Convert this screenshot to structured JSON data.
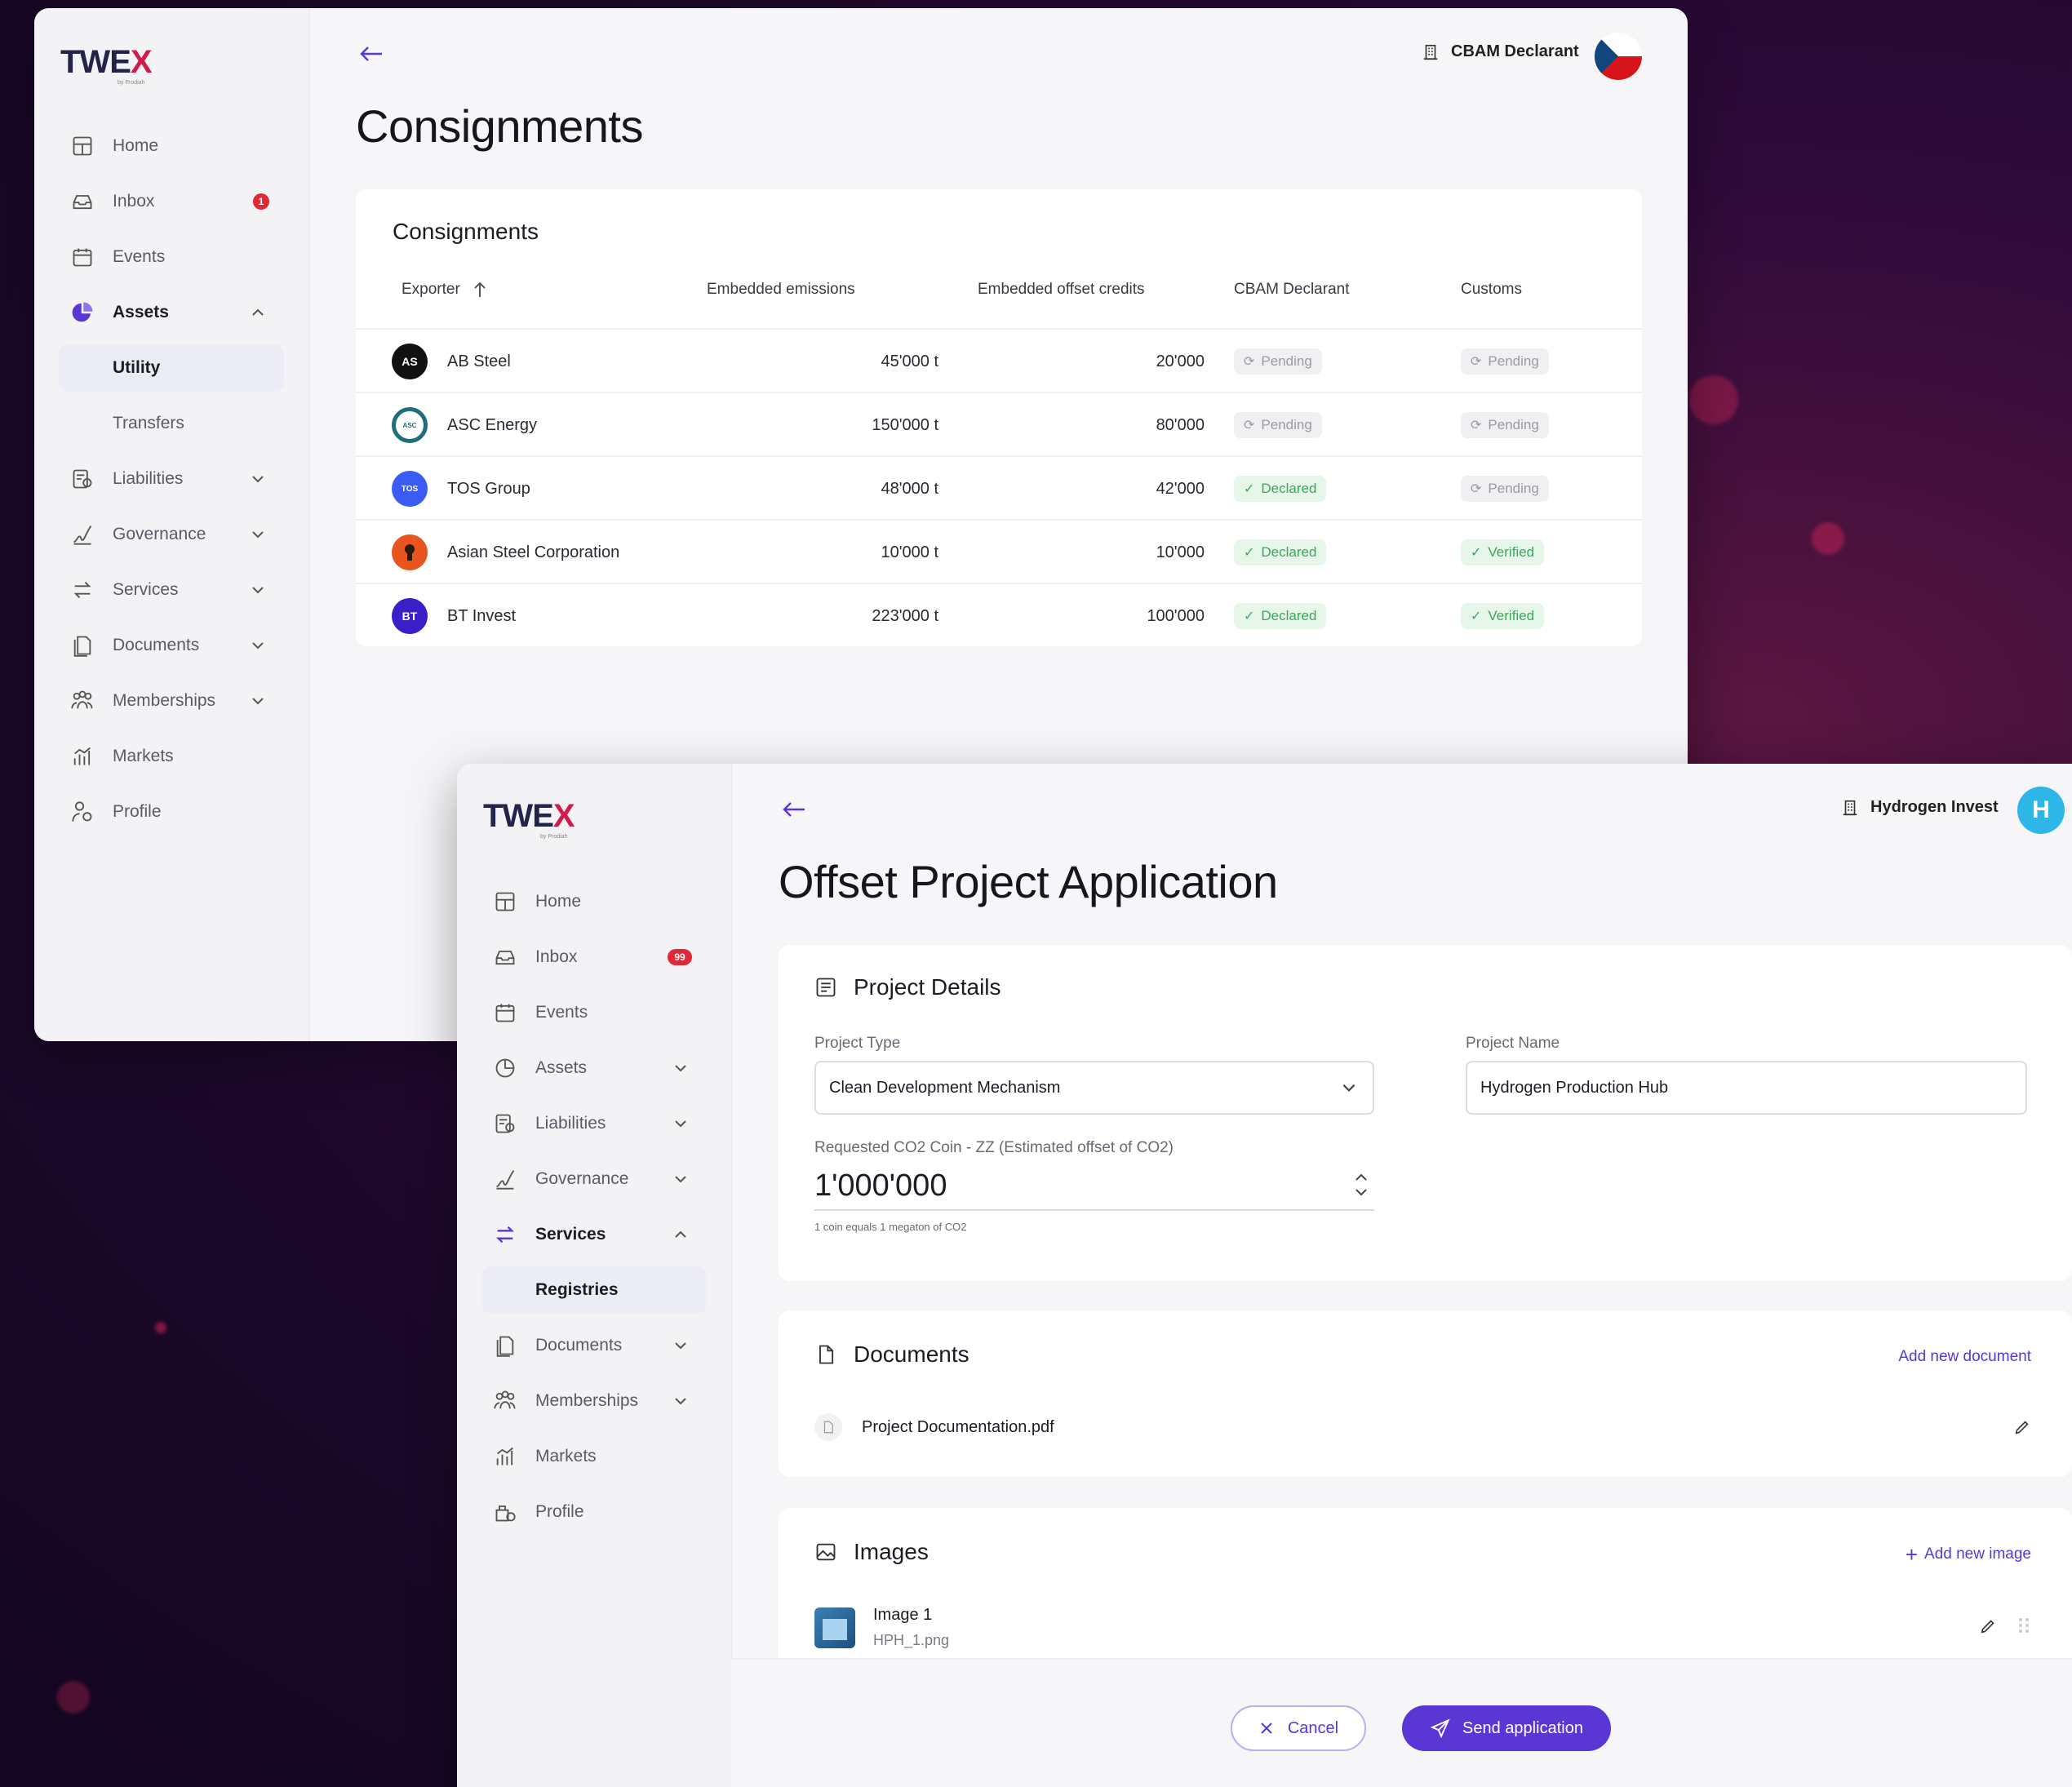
{
  "colors": {
    "accent": "#5a36d4",
    "brand_red": "#d11b4b",
    "declared": "#3aa85a",
    "pending": "#9a9aa4"
  },
  "window1": {
    "logo": {
      "text": "TWE",
      "x": "X",
      "sub": "by Prodiah"
    },
    "nav": [
      {
        "label": "Home",
        "icon": "home-icon"
      },
      {
        "label": "Inbox",
        "icon": "inbox-icon",
        "badge": "1"
      },
      {
        "label": "Events",
        "icon": "calendar-icon"
      },
      {
        "label": "Assets",
        "icon": "pie-chart-icon"
      },
      {
        "label": "Utility"
      },
      {
        "label": "Transfers"
      },
      {
        "label": "Liabilities",
        "icon": "liabilities-icon"
      },
      {
        "label": "Governance",
        "icon": "signature-icon"
      },
      {
        "label": "Services",
        "icon": "swap-icon"
      },
      {
        "label": "Documents",
        "icon": "documents-icon"
      },
      {
        "label": "Memberships",
        "icon": "people-icon"
      },
      {
        "label": "Markets",
        "icon": "chart-icon"
      },
      {
        "label": "Profile",
        "icon": "profile-icon"
      }
    ],
    "role": "CBAM Declarant",
    "page_title": "Consignments",
    "table": {
      "title": "Consignments",
      "headers": [
        "Exporter",
        "Embedded emissions",
        "Embedded offset credits",
        "CBAM Declarant",
        "Customs"
      ],
      "rows": [
        {
          "exporter": "AB Steel",
          "logo": "AS",
          "emissions": "45'000 t",
          "credits": "20'000",
          "declarant": "Pending",
          "customs": "Pending"
        },
        {
          "exporter": "ASC Energy",
          "logo": "ASC",
          "emissions": "150'000 t",
          "credits": "80'000",
          "declarant": "Pending",
          "customs": "Pending"
        },
        {
          "exporter": "TOS Group",
          "logo": "TOS",
          "emissions": "48'000 t",
          "credits": "42'000",
          "declarant": "Declared",
          "customs": "Pending"
        },
        {
          "exporter": "Asian Steel Corporation",
          "logo": "",
          "emissions": "10'000 t",
          "credits": "10'000",
          "declarant": "Declared",
          "customs": "Verified"
        },
        {
          "exporter": "BT Invest",
          "logo": "BT",
          "emissions": "223'000 t",
          "credits": "100'000",
          "declarant": "Declared",
          "customs": "Verified"
        }
      ]
    }
  },
  "window2": {
    "logo": {
      "text": "TWE",
      "x": "X",
      "sub": "by Prodiah"
    },
    "nav": [
      {
        "label": "Home",
        "icon": "home-icon"
      },
      {
        "label": "Inbox",
        "icon": "inbox-icon",
        "badge": "99"
      },
      {
        "label": "Events",
        "icon": "calendar-icon"
      },
      {
        "label": "Assets",
        "icon": "assets-icon"
      },
      {
        "label": "Liabilities",
        "icon": "liabilities-icon"
      },
      {
        "label": "Governance",
        "icon": "signature-icon"
      },
      {
        "label": "Services",
        "icon": "swap-icon"
      },
      {
        "label": "Registries"
      },
      {
        "label": "Documents",
        "icon": "documents-icon"
      },
      {
        "label": "Memberships",
        "icon": "people-icon"
      },
      {
        "label": "Markets",
        "icon": "chart-icon"
      },
      {
        "label": "Profile",
        "icon": "profile-icon"
      }
    ],
    "role": "Hydrogen Invest",
    "avatar_letter": "H",
    "page_title": "Offset Project Application",
    "project_details": {
      "title": "Project Details",
      "type_label": "Project Type",
      "type_value": "Clean Development Mechanism",
      "name_label": "Project Name",
      "name_value": "Hydrogen Production Hub",
      "coin_label": "Requested CO2 Coin - ZZ (Estimated offset of CO2)",
      "coin_value": "1'000'000",
      "coin_hint": "1 coin equals 1 megaton of CO2"
    },
    "documents": {
      "title": "Documents",
      "add_label": "Add new document",
      "file": "Project Documentation.pdf"
    },
    "images": {
      "title": "Images",
      "add_label": "Add new image",
      "item_title": "Image 1",
      "item_file": "HPH_1.png"
    },
    "actions": {
      "cancel": "Cancel",
      "send": "Send application"
    }
  }
}
